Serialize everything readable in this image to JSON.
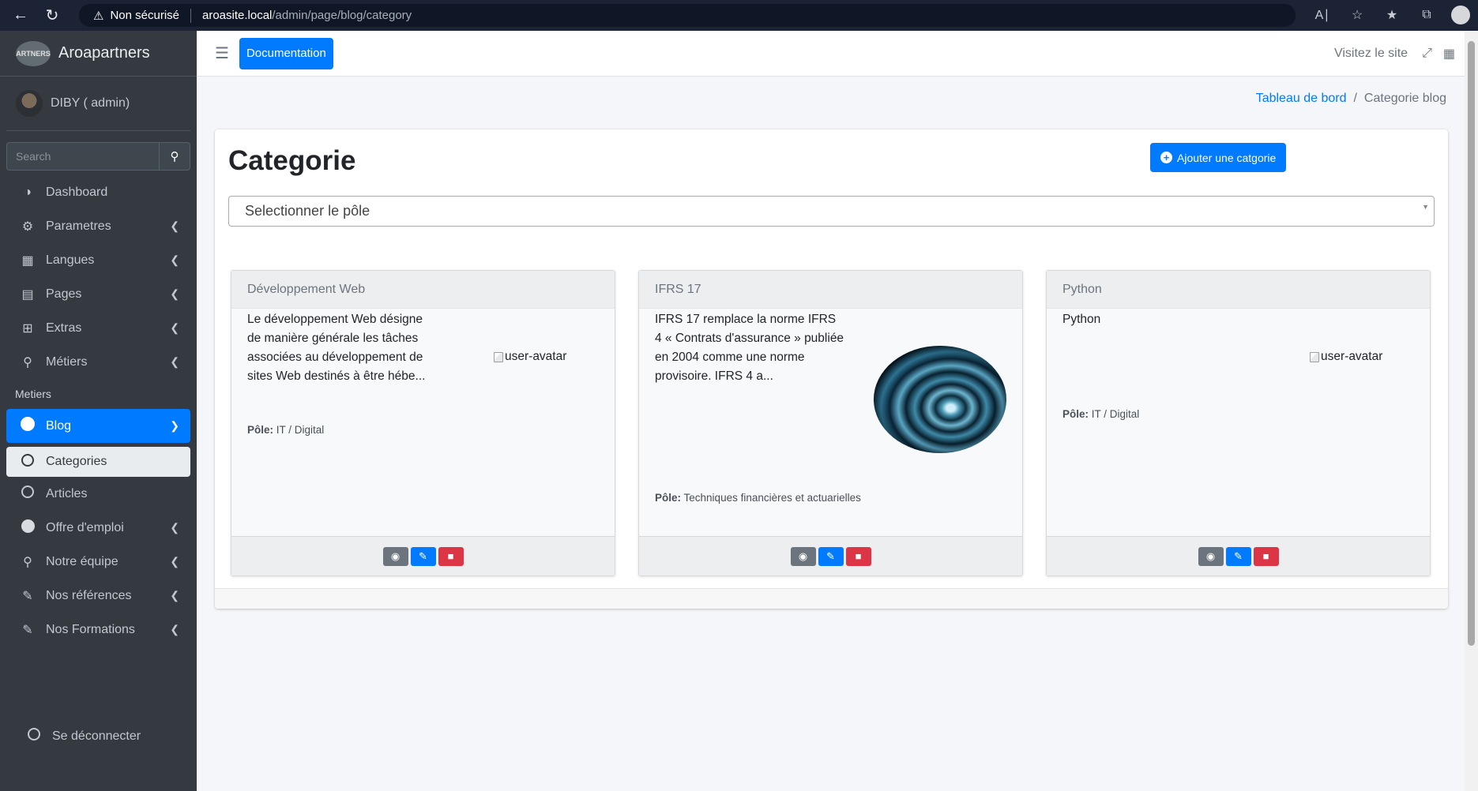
{
  "browser": {
    "security_label": "Non sécurisé",
    "url_host": "aroasite.local",
    "url_path": "/admin/page/blog/category"
  },
  "sidebar": {
    "brand": "Aroapartners",
    "brand_logo_text": "ARTNERS",
    "user": "DIBY ( admin)",
    "search_placeholder": "Search",
    "items": [
      {
        "label": "Dashboard",
        "icon": "tachometer-icon"
      },
      {
        "label": "Parametres",
        "icon": "users-cog-icon"
      },
      {
        "label": "Langues",
        "icon": "language-icon"
      },
      {
        "label": "Pages",
        "icon": "book-icon"
      },
      {
        "label": "Extras",
        "icon": "plus-square-icon"
      },
      {
        "label": "Métiers",
        "icon": "search-icon"
      }
    ],
    "section_header": "Metiers",
    "blog": {
      "label": "Blog",
      "categories": "Categories",
      "articles": "Articles"
    },
    "items2": [
      {
        "label": "Offre d'emploi",
        "icon": "circle-icon"
      },
      {
        "label": "Notre équipe",
        "icon": "search-icon"
      },
      {
        "label": "Nos références",
        "icon": "edit-icon"
      },
      {
        "label": "Nos Formations",
        "icon": "edit-icon"
      }
    ],
    "logout": "Se déconnecter"
  },
  "topnav": {
    "documentation": "Documentation",
    "visit": "Visitez le site"
  },
  "breadcrumb": {
    "home": "Tableau de bord",
    "separator": "/",
    "current": "Categorie blog"
  },
  "page": {
    "title": "Categorie",
    "add_button": "Ajouter une catgorie",
    "select_placeholder": "Selectionner le pôle"
  },
  "categories": [
    {
      "title": "Développement Web",
      "description": "Le développement Web désigne de manière générale les tâches associées au développement de sites Web destinés à être hébe...",
      "image_alt": "user-avatar",
      "pole_label": "Pôle:",
      "pole": "IT / Digital"
    },
    {
      "title": "IFRS 17",
      "description": "IFRS 17 remplace la norme IFRS 4 « Contrats d'assurance » publiée en 2004 comme une norme provisoire. IFRS 4 a...",
      "pole_label": "Pôle:",
      "pole": "Techniques financières et actuarielles"
    },
    {
      "title": "Python",
      "description": "Python",
      "image_alt": "user-avatar",
      "pole_label": "Pôle:",
      "pole": "IT / Digital"
    }
  ],
  "colors": {
    "primary": "#007bff",
    "sidebar": "#343a40",
    "danger": "#dc3545",
    "secondary": "#6c757d"
  }
}
